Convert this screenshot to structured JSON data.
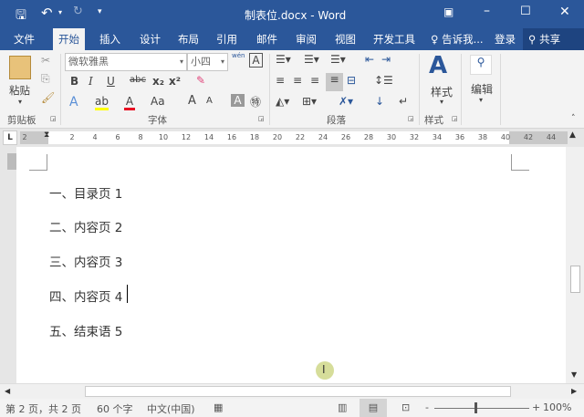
{
  "window": {
    "title": "制表位.docx - Word"
  },
  "quick_access": {
    "save_icon": "save-icon",
    "undo_icon": "undo-icon",
    "redo_icon": "redo-icon",
    "customize_icon": "customize-icon"
  },
  "tabs": [
    {
      "label": "文件"
    },
    {
      "label": "开始"
    },
    {
      "label": "插入"
    },
    {
      "label": "设计"
    },
    {
      "label": "布局"
    },
    {
      "label": "引用"
    },
    {
      "label": "邮件"
    },
    {
      "label": "审阅"
    },
    {
      "label": "视图"
    },
    {
      "label": "开发工具"
    }
  ],
  "tell_me": "告诉我...",
  "login": "登录",
  "share": "共享",
  "ribbon": {
    "clipboard": {
      "label": "剪贴板",
      "paste": "粘贴"
    },
    "font": {
      "label": "字体",
      "font_name": "微软雅黑",
      "font_size": "小四",
      "bold": "B",
      "italic": "I",
      "underline": "U",
      "strike": "abc",
      "sub": "x₂",
      "sup": "x²",
      "case": "Aa",
      "grow": "A",
      "shrink": "A",
      "wen": "wén"
    },
    "paragraph": {
      "label": "段落"
    },
    "styles": {
      "label": "样式",
      "button": "样式"
    },
    "editing": {
      "button": "编辑"
    }
  },
  "ruler": {
    "numbers": [
      "2",
      "2",
      "4",
      "6",
      "8",
      "10",
      "12",
      "14",
      "16",
      "18",
      "20",
      "22",
      "24",
      "26",
      "28",
      "30",
      "32",
      "34",
      "36",
      "38",
      "40",
      "42",
      "44"
    ]
  },
  "document": {
    "lines": [
      "一、目录页 1",
      "二、内容页 2",
      "三、内容页 3",
      "四、内容页 4",
      "五、结束语 5"
    ]
  },
  "status": {
    "page": "第 2 页，共 2 页",
    "words": "60 个字",
    "language": "中文(中国)",
    "zoom": "100%",
    "zoom_minus": "-",
    "zoom_plus": "+"
  },
  "colors": {
    "brand": "#2b579a",
    "highlight": "#ffff00",
    "font_color": "#e81123"
  }
}
